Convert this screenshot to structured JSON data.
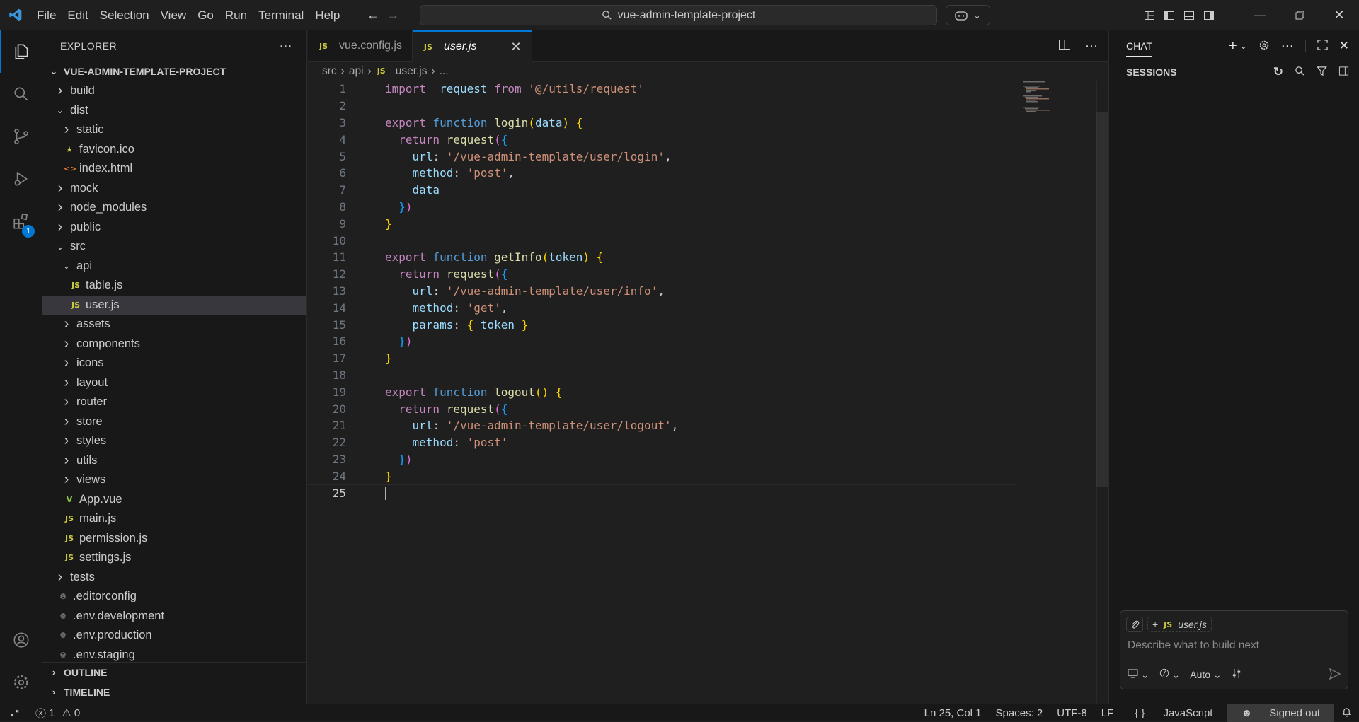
{
  "titlebar": {
    "menu": [
      "File",
      "Edit",
      "Selection",
      "View",
      "Go",
      "Run",
      "Terminal",
      "Help"
    ],
    "search": "vue-admin-template-project"
  },
  "explorer": {
    "header": "EXPLORER",
    "project": "VUE-ADMIN-TEMPLATE-PROJECT",
    "tree": [
      {
        "label": "build",
        "type": "folder",
        "open": false,
        "depth": 1
      },
      {
        "label": "dist",
        "type": "folder",
        "open": true,
        "depth": 1
      },
      {
        "label": "static",
        "type": "folder",
        "open": false,
        "depth": 2
      },
      {
        "label": "favicon.ico",
        "type": "star",
        "depth": 2
      },
      {
        "label": "index.html",
        "type": "html",
        "depth": 2
      },
      {
        "label": "mock",
        "type": "folder",
        "open": false,
        "depth": 1
      },
      {
        "label": "node_modules",
        "type": "folder",
        "open": false,
        "depth": 1
      },
      {
        "label": "public",
        "type": "folder",
        "open": false,
        "depth": 1
      },
      {
        "label": "src",
        "type": "folder",
        "open": true,
        "depth": 1
      },
      {
        "label": "api",
        "type": "folder",
        "open": true,
        "depth": 2
      },
      {
        "label": "table.js",
        "type": "js",
        "depth": 3
      },
      {
        "label": "user.js",
        "type": "js",
        "depth": 3,
        "selected": true
      },
      {
        "label": "assets",
        "type": "folder",
        "open": false,
        "depth": 2
      },
      {
        "label": "components",
        "type": "folder",
        "open": false,
        "depth": 2
      },
      {
        "label": "icons",
        "type": "folder",
        "open": false,
        "depth": 2
      },
      {
        "label": "layout",
        "type": "folder",
        "open": false,
        "depth": 2
      },
      {
        "label": "router",
        "type": "folder",
        "open": false,
        "depth": 2
      },
      {
        "label": "store",
        "type": "folder",
        "open": false,
        "depth": 2
      },
      {
        "label": "styles",
        "type": "folder",
        "open": false,
        "depth": 2
      },
      {
        "label": "utils",
        "type": "folder",
        "open": false,
        "depth": 2
      },
      {
        "label": "views",
        "type": "folder",
        "open": false,
        "depth": 2
      },
      {
        "label": "App.vue",
        "type": "vue",
        "depth": 2
      },
      {
        "label": "main.js",
        "type": "js",
        "depth": 2
      },
      {
        "label": "permission.js",
        "type": "js",
        "depth": 2
      },
      {
        "label": "settings.js",
        "type": "js",
        "depth": 2
      },
      {
        "label": "tests",
        "type": "folder",
        "open": false,
        "depth": 1
      },
      {
        "label": ".editorconfig",
        "type": "gear",
        "depth": 1
      },
      {
        "label": ".env.development",
        "type": "gear",
        "depth": 1
      },
      {
        "label": ".env.production",
        "type": "gear",
        "depth": 1
      },
      {
        "label": ".env.staging",
        "type": "gear",
        "depth": 1
      }
    ],
    "outline": "OUTLINE",
    "timeline": "TIMELINE"
  },
  "tabs": [
    {
      "label": "vue.config.js",
      "active": false
    },
    {
      "label": "user.js",
      "active": true
    }
  ],
  "breadcrumb": [
    "src",
    "api",
    "user.js",
    "..."
  ],
  "code": {
    "lines": [
      [
        [
          "kw",
          "import"
        ],
        [
          "",
          "  "
        ],
        [
          "vr",
          "request"
        ],
        [
          "",
          ""
        ],
        [
          "kw",
          " from "
        ],
        [
          "str",
          "'@/utils/request'"
        ]
      ],
      [],
      [
        [
          "kw",
          "export"
        ],
        [
          "kb",
          " function "
        ],
        [
          "fn",
          "login"
        ],
        [
          "br1",
          "("
        ],
        [
          "vr",
          "data"
        ],
        [
          "br1",
          ")"
        ],
        [
          "",
          " "
        ],
        [
          "br1",
          "{"
        ]
      ],
      [
        [
          "",
          "  "
        ],
        [
          "kw",
          "return"
        ],
        [
          "",
          " "
        ],
        [
          "fn",
          "request"
        ],
        [
          "br2",
          "("
        ],
        [
          "br3",
          "{"
        ]
      ],
      [
        [
          "",
          "    "
        ],
        [
          "vr",
          "url"
        ],
        [
          "",
          ": "
        ],
        [
          "str",
          "'/vue-admin-template/user/login'"
        ],
        [
          "",
          ","
        ]
      ],
      [
        [
          "",
          "    "
        ],
        [
          "vr",
          "method"
        ],
        [
          "",
          ": "
        ],
        [
          "str",
          "'post'"
        ],
        [
          "",
          ","
        ]
      ],
      [
        [
          "",
          "    "
        ],
        [
          "vr",
          "data"
        ]
      ],
      [
        [
          "",
          "  "
        ],
        [
          "br3",
          "}"
        ],
        [
          "br2",
          ")"
        ]
      ],
      [
        [
          "br1",
          "}"
        ]
      ],
      [],
      [
        [
          "kw",
          "export"
        ],
        [
          "kb",
          " function "
        ],
        [
          "fn",
          "getInfo"
        ],
        [
          "br1",
          "("
        ],
        [
          "vr",
          "token"
        ],
        [
          "br1",
          ")"
        ],
        [
          "",
          " "
        ],
        [
          "br1",
          "{"
        ]
      ],
      [
        [
          "",
          "  "
        ],
        [
          "kw",
          "return"
        ],
        [
          "",
          " "
        ],
        [
          "fn",
          "request"
        ],
        [
          "br2",
          "("
        ],
        [
          "br3",
          "{"
        ]
      ],
      [
        [
          "",
          "    "
        ],
        [
          "vr",
          "url"
        ],
        [
          "",
          ": "
        ],
        [
          "str",
          "'/vue-admin-template/user/info'"
        ],
        [
          "",
          ","
        ]
      ],
      [
        [
          "",
          "    "
        ],
        [
          "vr",
          "method"
        ],
        [
          "",
          ": "
        ],
        [
          "str",
          "'get'"
        ],
        [
          "",
          ","
        ]
      ],
      [
        [
          "",
          "    "
        ],
        [
          "vr",
          "params"
        ],
        [
          "",
          ": "
        ],
        [
          "br1",
          "{"
        ],
        [
          "",
          " "
        ],
        [
          "vr",
          "token"
        ],
        [
          "",
          " "
        ],
        [
          "br1",
          "}"
        ]
      ],
      [
        [
          "",
          "  "
        ],
        [
          "br3",
          "}"
        ],
        [
          "br2",
          ")"
        ]
      ],
      [
        [
          "br1",
          "}"
        ]
      ],
      [],
      [
        [
          "kw",
          "export"
        ],
        [
          "kb",
          " function "
        ],
        [
          "fn",
          "logout"
        ],
        [
          "br1",
          "()"
        ],
        [
          "",
          " "
        ],
        [
          "br1",
          "{"
        ]
      ],
      [
        [
          "",
          "  "
        ],
        [
          "kw",
          "return"
        ],
        [
          "",
          " "
        ],
        [
          "fn",
          "request"
        ],
        [
          "br2",
          "("
        ],
        [
          "br3",
          "{"
        ]
      ],
      [
        [
          "",
          "    "
        ],
        [
          "vr",
          "url"
        ],
        [
          "",
          ": "
        ],
        [
          "str",
          "'/vue-admin-template/user/logout'"
        ],
        [
          "",
          ","
        ]
      ],
      [
        [
          "",
          "    "
        ],
        [
          "vr",
          "method"
        ],
        [
          "",
          ": "
        ],
        [
          "str",
          "'post'"
        ]
      ],
      [
        [
          "",
          "  "
        ],
        [
          "br3",
          "}"
        ],
        [
          "br2",
          ")"
        ]
      ],
      [
        [
          "br1",
          "}"
        ]
      ],
      []
    ],
    "current_line": 25
  },
  "chat": {
    "title": "CHAT",
    "sessions": "SESSIONS",
    "context_file": "user.js",
    "placeholder": "Describe what to build next",
    "mode": "Auto"
  },
  "statusbar": {
    "errors": "1",
    "warnings": "0",
    "position": "Ln 25, Col 1",
    "spaces": "Spaces: 2",
    "encoding": "UTF-8",
    "eol": "LF",
    "language": "JavaScript",
    "account": "Signed out"
  },
  "colors": {
    "accent": "#0078d4",
    "background": "#1f1f1f",
    "sidebar": "#181818"
  }
}
